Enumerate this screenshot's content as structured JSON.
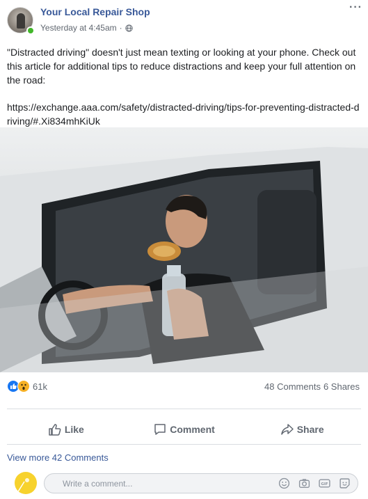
{
  "post": {
    "page_name": "Your Local Repair Shop",
    "timestamp": "Yesterday at 4:45am",
    "separator": "·",
    "more_label": "···",
    "text": "\"Distracted driving\" doesn't just mean texting or looking at your phone. Check out this article for additional tips to reduce distractions and keep your full attention on the road:",
    "link": "https://exchange.aaa.com/safety/distracted-driving/tips-for-preventing-distracted-driving/#.Xi834mhKiUk"
  },
  "engagement": {
    "reactions_count": "61k",
    "reaction_icons": [
      "like-icon",
      "wow-icon"
    ],
    "comments": "48 Comments",
    "shares": "6 Shares"
  },
  "actions": {
    "like": "Like",
    "comment": "Comment",
    "share": "Share"
  },
  "comments": {
    "view_more": "View more 42 Comments",
    "placeholder": "Write a comment...",
    "tool_icons": [
      "emoji-icon",
      "camera-icon",
      "gif-icon",
      "sticker-icon"
    ]
  },
  "colors": {
    "link_blue": "#385898",
    "like_blue": "#1877f2",
    "online_green": "#42b72a",
    "wow_yellow": "#f7b125"
  }
}
